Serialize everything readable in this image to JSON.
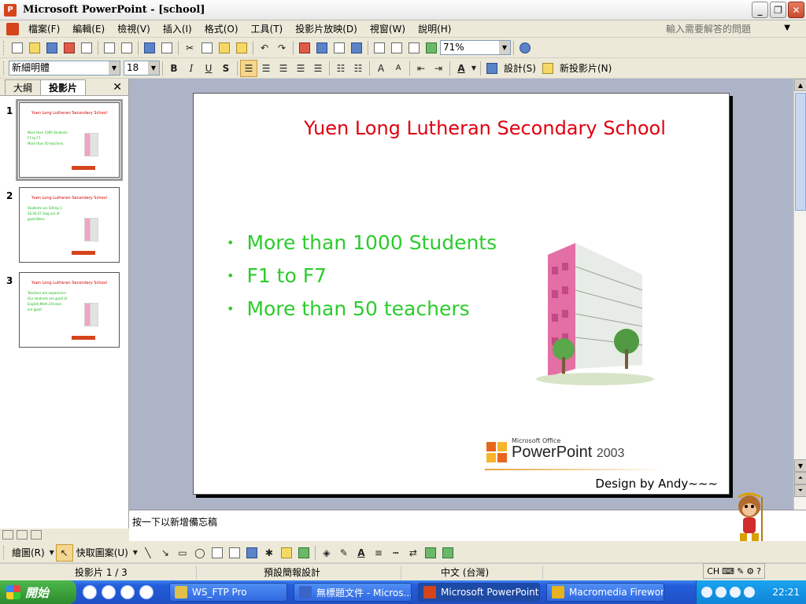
{
  "window": {
    "title": "Microsoft PowerPoint - [school]"
  },
  "menu": {
    "items": [
      "檔案(F)",
      "編輯(E)",
      "檢視(V)",
      "插入(I)",
      "格式(O)",
      "工具(T)",
      "投影片放映(D)",
      "視窗(W)",
      "說明(H)"
    ],
    "help_placeholder": "輸入需要解答的問題"
  },
  "toolbar_standard": {
    "zoom": "71%"
  },
  "toolbar_format": {
    "font_name": "新細明體",
    "font_size": "18",
    "bold": "B",
    "italic": "I",
    "underline": "U",
    "shadow": "S",
    "design_label": "設計(S)",
    "new_slide_label": "新投影片(N)"
  },
  "left_pane": {
    "tabs": [
      "大綱",
      "投影片"
    ],
    "slides": [
      {
        "num": "1",
        "title": "Yuen Long Lutheran Secondary School",
        "body": [
          "More than 1000 Students",
          "F1 to F7",
          "More than 50 teachers"
        ]
      },
      {
        "num": "2",
        "title": "Yuen Long Lutheran Secondary School",
        "body": [
          "Students are Sitting 1",
          "SS,S4,S7 stag are of",
          "good Bless"
        ]
      },
      {
        "num": "3",
        "title": "Yuen Long Lutheran Secondary School",
        "body": [
          "Teachers are experience",
          "Our students are good at",
          "English,Math,Chinese",
          "are good"
        ]
      }
    ]
  },
  "slide": {
    "title": "Yuen Long Lutheran Secondary School",
    "bullets": [
      "More than 1000 Students",
      "F1 to F7",
      "More than 50 teachers"
    ],
    "logo_small": "Microsoft Office",
    "logo_main": "PowerPoint",
    "logo_version": "2003",
    "author": "Design by Andy~~~"
  },
  "notes": {
    "placeholder": "按一下以新增備忘稿"
  },
  "toolbar_drawing": {
    "draw_label": "繪圖(R)",
    "autoshapes_label": "快取圖案(U)"
  },
  "status": {
    "slide": "投影片 1 / 3",
    "design": "預設簡報設計",
    "language": "中文 (台灣)",
    "ime": "CH"
  },
  "taskbar": {
    "start_label": "開始",
    "buttons": [
      "WS_FTP Pro",
      "無標題文件 - Micros...",
      "Microsoft PowerPoint ...",
      "Macromedia Fireworks..."
    ],
    "clock": "22:21"
  },
  "colors": {
    "title_red": "#e0000f",
    "bullet_green": "#2ccc2c",
    "taskbar_blue": "#245edb"
  }
}
